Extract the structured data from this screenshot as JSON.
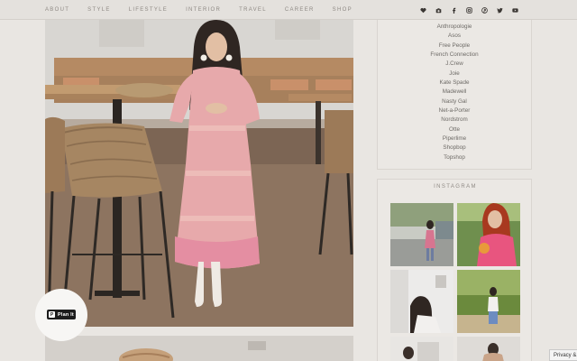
{
  "nav": {
    "links": [
      "ABOUT",
      "STYLE",
      "LIFESTYLE",
      "INTERIOR",
      "TRAVEL",
      "CAREER",
      "SHOP"
    ],
    "social_icons": [
      "heart-icon",
      "camera-icon",
      "facebook-icon",
      "instagram-icon",
      "pinterest-icon",
      "twitter-icon",
      "youtube-icon"
    ]
  },
  "main": {
    "plan_button_label": "Plan It",
    "plan_logo": "P"
  },
  "sidebar": {
    "brands": [
      "Anthropologie",
      "Asos",
      "Free People",
      "French Connection",
      "J.Crew",
      "Joie",
      "Kate Spade",
      "Madewell",
      "Nasty Gal",
      "Net-a-Porter",
      "Nordstrom",
      "Otte",
      "Piperlime",
      "Shopbop",
      "Topshop"
    ],
    "instagram_title": "INSTAGRAM"
  },
  "footer": {
    "privacy_label": "Privacy &"
  },
  "colors": {
    "nav_text": "#8f8a85",
    "brand_text": "#6d6a66",
    "plan_button": "#1c1c1c",
    "page_bg": "#e9e6e2"
  }
}
